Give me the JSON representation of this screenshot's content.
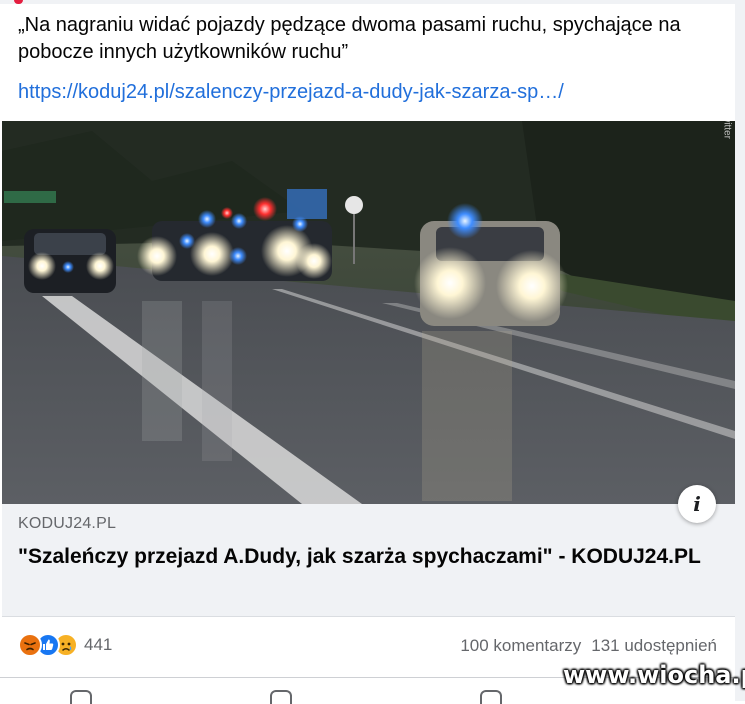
{
  "post": {
    "text": "„Na nagraniu widać pojazdy pędzące dwoma pasami ruchu, spychające na pobocze innych użytkowników ruchu”",
    "link": "https://koduj24.pl/szalenczy-przejazd-a-dudy-jak-szarza-sp…/"
  },
  "image": {
    "source_watermark": "fb: twitter",
    "info_icon": "info-icon"
  },
  "preview": {
    "domain": "KODUJ24.PL",
    "headline": "\"Szaleńczy przejazd A.Dudy, jak szarża spychaczami\" - KODUJ24.PL"
  },
  "stats": {
    "reactions": [
      "angry-reaction-icon",
      "like-reaction-icon",
      "sad-reaction-icon"
    ],
    "reaction_count": "441",
    "comments": "100 komentarzy",
    "shares": "131 udostępnień"
  },
  "watermark": "www.wiocha.pl",
  "colors": {
    "link": "#216fdb",
    "secondary_text": "#65676b",
    "preview_bg": "#f0f2f5",
    "like": "#1877f2",
    "angry": "#e9710f",
    "sad": "#f7b125"
  }
}
